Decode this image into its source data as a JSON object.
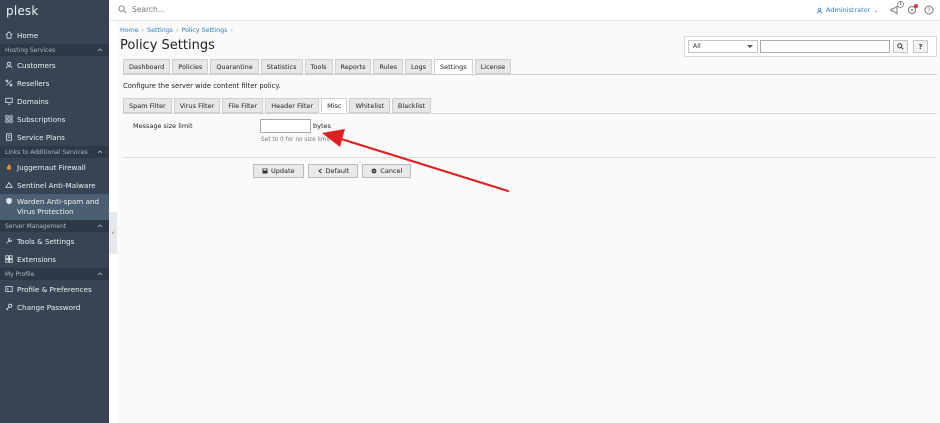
{
  "app": {
    "logo": "plesk"
  },
  "topbar": {
    "search_placeholder": "Search...",
    "user": "Administrator",
    "notification_count": "1"
  },
  "sidebar": {
    "home": "Home",
    "group_hosting": "Hosting Services",
    "customers": "Customers",
    "resellers": "Resellers",
    "domains": "Domains",
    "subscriptions": "Subscriptions",
    "service_plans": "Service Plans",
    "group_links": "Links to Additional Services",
    "juggernaut": "Juggernaut Firewall",
    "sentinel": "Sentinel Anti-Malware",
    "warden": "Warden Anti-spam and Virus Protection",
    "group_server": "Server Management",
    "tools_settings": "Tools & Settings",
    "extensions": "Extensions",
    "group_profile": "My Profile",
    "profile_prefs": "Profile & Preferences",
    "change_password": "Change Password"
  },
  "breadcrumb": [
    "Home",
    "Settings",
    "Policy Settings"
  ],
  "page_title": "Policy Settings",
  "filter": {
    "selected": "All",
    "value": ""
  },
  "tabs": [
    "Dashboard",
    "Policies",
    "Quarantine",
    "Statistics",
    "Tools",
    "Reports",
    "Rules",
    "Logs",
    "Settings",
    "License"
  ],
  "active_tab": "Settings",
  "description": "Configure the server wide content filter policy.",
  "subtabs": [
    "Spam Filter",
    "Virus Filter",
    "File Filter",
    "Header Filter",
    "Misc",
    "Whitelist",
    "Blacklist"
  ],
  "active_subtab": "Misc",
  "form": {
    "label": "Message size limit",
    "value": "",
    "unit": "bytes",
    "hint": "Set to 0 for no size limit"
  },
  "buttons": {
    "update": "Update",
    "default": "Default",
    "cancel": "Cancel"
  },
  "colors": {
    "sidebar": "#364453",
    "link": "#2d7dc8",
    "annotation_arrow": "#e02020"
  }
}
